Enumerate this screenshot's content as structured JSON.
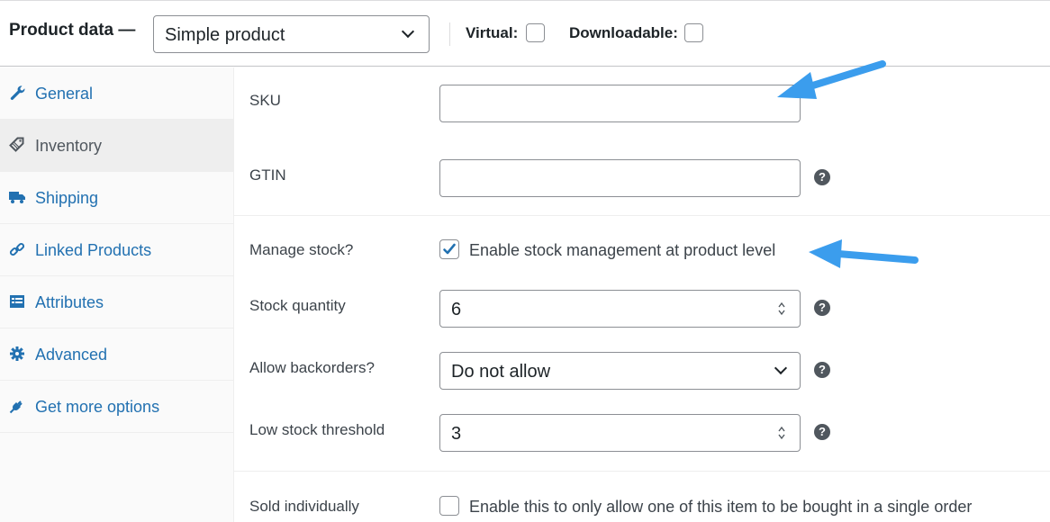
{
  "header": {
    "title": "Product data —",
    "product_type": "Simple product",
    "virtual_label": "Virtual:",
    "downloadable_label": "Downloadable:"
  },
  "sidebar": {
    "items": [
      {
        "label": "General",
        "icon": "wrench-icon"
      },
      {
        "label": "Inventory",
        "icon": "tag-icon",
        "active": true
      },
      {
        "label": "Shipping",
        "icon": "truck-icon"
      },
      {
        "label": "Linked Products",
        "icon": "link-icon"
      },
      {
        "label": "Attributes",
        "icon": "list-icon"
      },
      {
        "label": "Advanced",
        "icon": "gear-icon"
      },
      {
        "label": "Get more options",
        "icon": "plug-icon"
      }
    ]
  },
  "fields": {
    "sku": {
      "label": "SKU",
      "value": ""
    },
    "gtin": {
      "label": "GTIN",
      "value": ""
    },
    "manage_stock": {
      "label": "Manage stock?",
      "checkbox_text": "Enable stock management at product level",
      "checked": true
    },
    "stock_quantity": {
      "label": "Stock quantity",
      "value": "6"
    },
    "backorders": {
      "label": "Allow backorders?",
      "value": "Do not allow"
    },
    "low_stock": {
      "label": "Low stock threshold",
      "value": "3"
    },
    "sold_individually": {
      "label": "Sold individually",
      "checkbox_text": "Enable this to only allow one of this item to be bought in a single order",
      "checked": false
    }
  },
  "help_icon_glyph": "?",
  "colors": {
    "link": "#2271b1",
    "checkbox_check": "#2271b1",
    "annotation_arrow": "#3b9ded"
  }
}
